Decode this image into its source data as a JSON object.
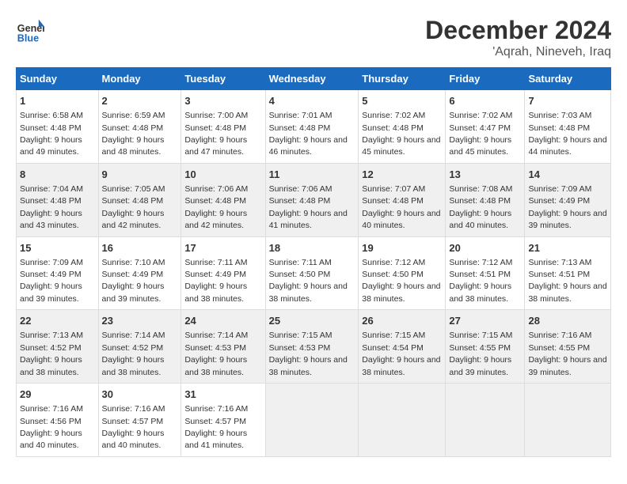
{
  "logo": {
    "line1": "General",
    "line2": "Blue"
  },
  "title": "December 2024",
  "subtitle": "'Aqrah, Nineveh, Iraq",
  "days_of_week": [
    "Sunday",
    "Monday",
    "Tuesday",
    "Wednesday",
    "Thursday",
    "Friday",
    "Saturday"
  ],
  "weeks": [
    [
      {
        "day": 1,
        "sunrise": "6:58 AM",
        "sunset": "4:48 PM",
        "daylight": "9 hours and 49 minutes."
      },
      {
        "day": 2,
        "sunrise": "6:59 AM",
        "sunset": "4:48 PM",
        "daylight": "9 hours and 48 minutes."
      },
      {
        "day": 3,
        "sunrise": "7:00 AM",
        "sunset": "4:48 PM",
        "daylight": "9 hours and 47 minutes."
      },
      {
        "day": 4,
        "sunrise": "7:01 AM",
        "sunset": "4:48 PM",
        "daylight": "9 hours and 46 minutes."
      },
      {
        "day": 5,
        "sunrise": "7:02 AM",
        "sunset": "4:48 PM",
        "daylight": "9 hours and 45 minutes."
      },
      {
        "day": 6,
        "sunrise": "7:02 AM",
        "sunset": "4:47 PM",
        "daylight": "9 hours and 45 minutes."
      },
      {
        "day": 7,
        "sunrise": "7:03 AM",
        "sunset": "4:48 PM",
        "daylight": "9 hours and 44 minutes."
      }
    ],
    [
      {
        "day": 8,
        "sunrise": "7:04 AM",
        "sunset": "4:48 PM",
        "daylight": "9 hours and 43 minutes."
      },
      {
        "day": 9,
        "sunrise": "7:05 AM",
        "sunset": "4:48 PM",
        "daylight": "9 hours and 42 minutes."
      },
      {
        "day": 10,
        "sunrise": "7:06 AM",
        "sunset": "4:48 PM",
        "daylight": "9 hours and 42 minutes."
      },
      {
        "day": 11,
        "sunrise": "7:06 AM",
        "sunset": "4:48 PM",
        "daylight": "9 hours and 41 minutes."
      },
      {
        "day": 12,
        "sunrise": "7:07 AM",
        "sunset": "4:48 PM",
        "daylight": "9 hours and 40 minutes."
      },
      {
        "day": 13,
        "sunrise": "7:08 AM",
        "sunset": "4:48 PM",
        "daylight": "9 hours and 40 minutes."
      },
      {
        "day": 14,
        "sunrise": "7:09 AM",
        "sunset": "4:49 PM",
        "daylight": "9 hours and 39 minutes."
      }
    ],
    [
      {
        "day": 15,
        "sunrise": "7:09 AM",
        "sunset": "4:49 PM",
        "daylight": "9 hours and 39 minutes."
      },
      {
        "day": 16,
        "sunrise": "7:10 AM",
        "sunset": "4:49 PM",
        "daylight": "9 hours and 39 minutes."
      },
      {
        "day": 17,
        "sunrise": "7:11 AM",
        "sunset": "4:49 PM",
        "daylight": "9 hours and 38 minutes."
      },
      {
        "day": 18,
        "sunrise": "7:11 AM",
        "sunset": "4:50 PM",
        "daylight": "9 hours and 38 minutes."
      },
      {
        "day": 19,
        "sunrise": "7:12 AM",
        "sunset": "4:50 PM",
        "daylight": "9 hours and 38 minutes."
      },
      {
        "day": 20,
        "sunrise": "7:12 AM",
        "sunset": "4:51 PM",
        "daylight": "9 hours and 38 minutes."
      },
      {
        "day": 21,
        "sunrise": "7:13 AM",
        "sunset": "4:51 PM",
        "daylight": "9 hours and 38 minutes."
      }
    ],
    [
      {
        "day": 22,
        "sunrise": "7:13 AM",
        "sunset": "4:52 PM",
        "daylight": "9 hours and 38 minutes."
      },
      {
        "day": 23,
        "sunrise": "7:14 AM",
        "sunset": "4:52 PM",
        "daylight": "9 hours and 38 minutes."
      },
      {
        "day": 24,
        "sunrise": "7:14 AM",
        "sunset": "4:53 PM",
        "daylight": "9 hours and 38 minutes."
      },
      {
        "day": 25,
        "sunrise": "7:15 AM",
        "sunset": "4:53 PM",
        "daylight": "9 hours and 38 minutes."
      },
      {
        "day": 26,
        "sunrise": "7:15 AM",
        "sunset": "4:54 PM",
        "daylight": "9 hours and 38 minutes."
      },
      {
        "day": 27,
        "sunrise": "7:15 AM",
        "sunset": "4:55 PM",
        "daylight": "9 hours and 39 minutes."
      },
      {
        "day": 28,
        "sunrise": "7:16 AM",
        "sunset": "4:55 PM",
        "daylight": "9 hours and 39 minutes."
      }
    ],
    [
      {
        "day": 29,
        "sunrise": "7:16 AM",
        "sunset": "4:56 PM",
        "daylight": "9 hours and 40 minutes."
      },
      {
        "day": 30,
        "sunrise": "7:16 AM",
        "sunset": "4:57 PM",
        "daylight": "9 hours and 40 minutes."
      },
      {
        "day": 31,
        "sunrise": "7:16 AM",
        "sunset": "4:57 PM",
        "daylight": "9 hours and 41 minutes."
      },
      null,
      null,
      null,
      null
    ]
  ]
}
